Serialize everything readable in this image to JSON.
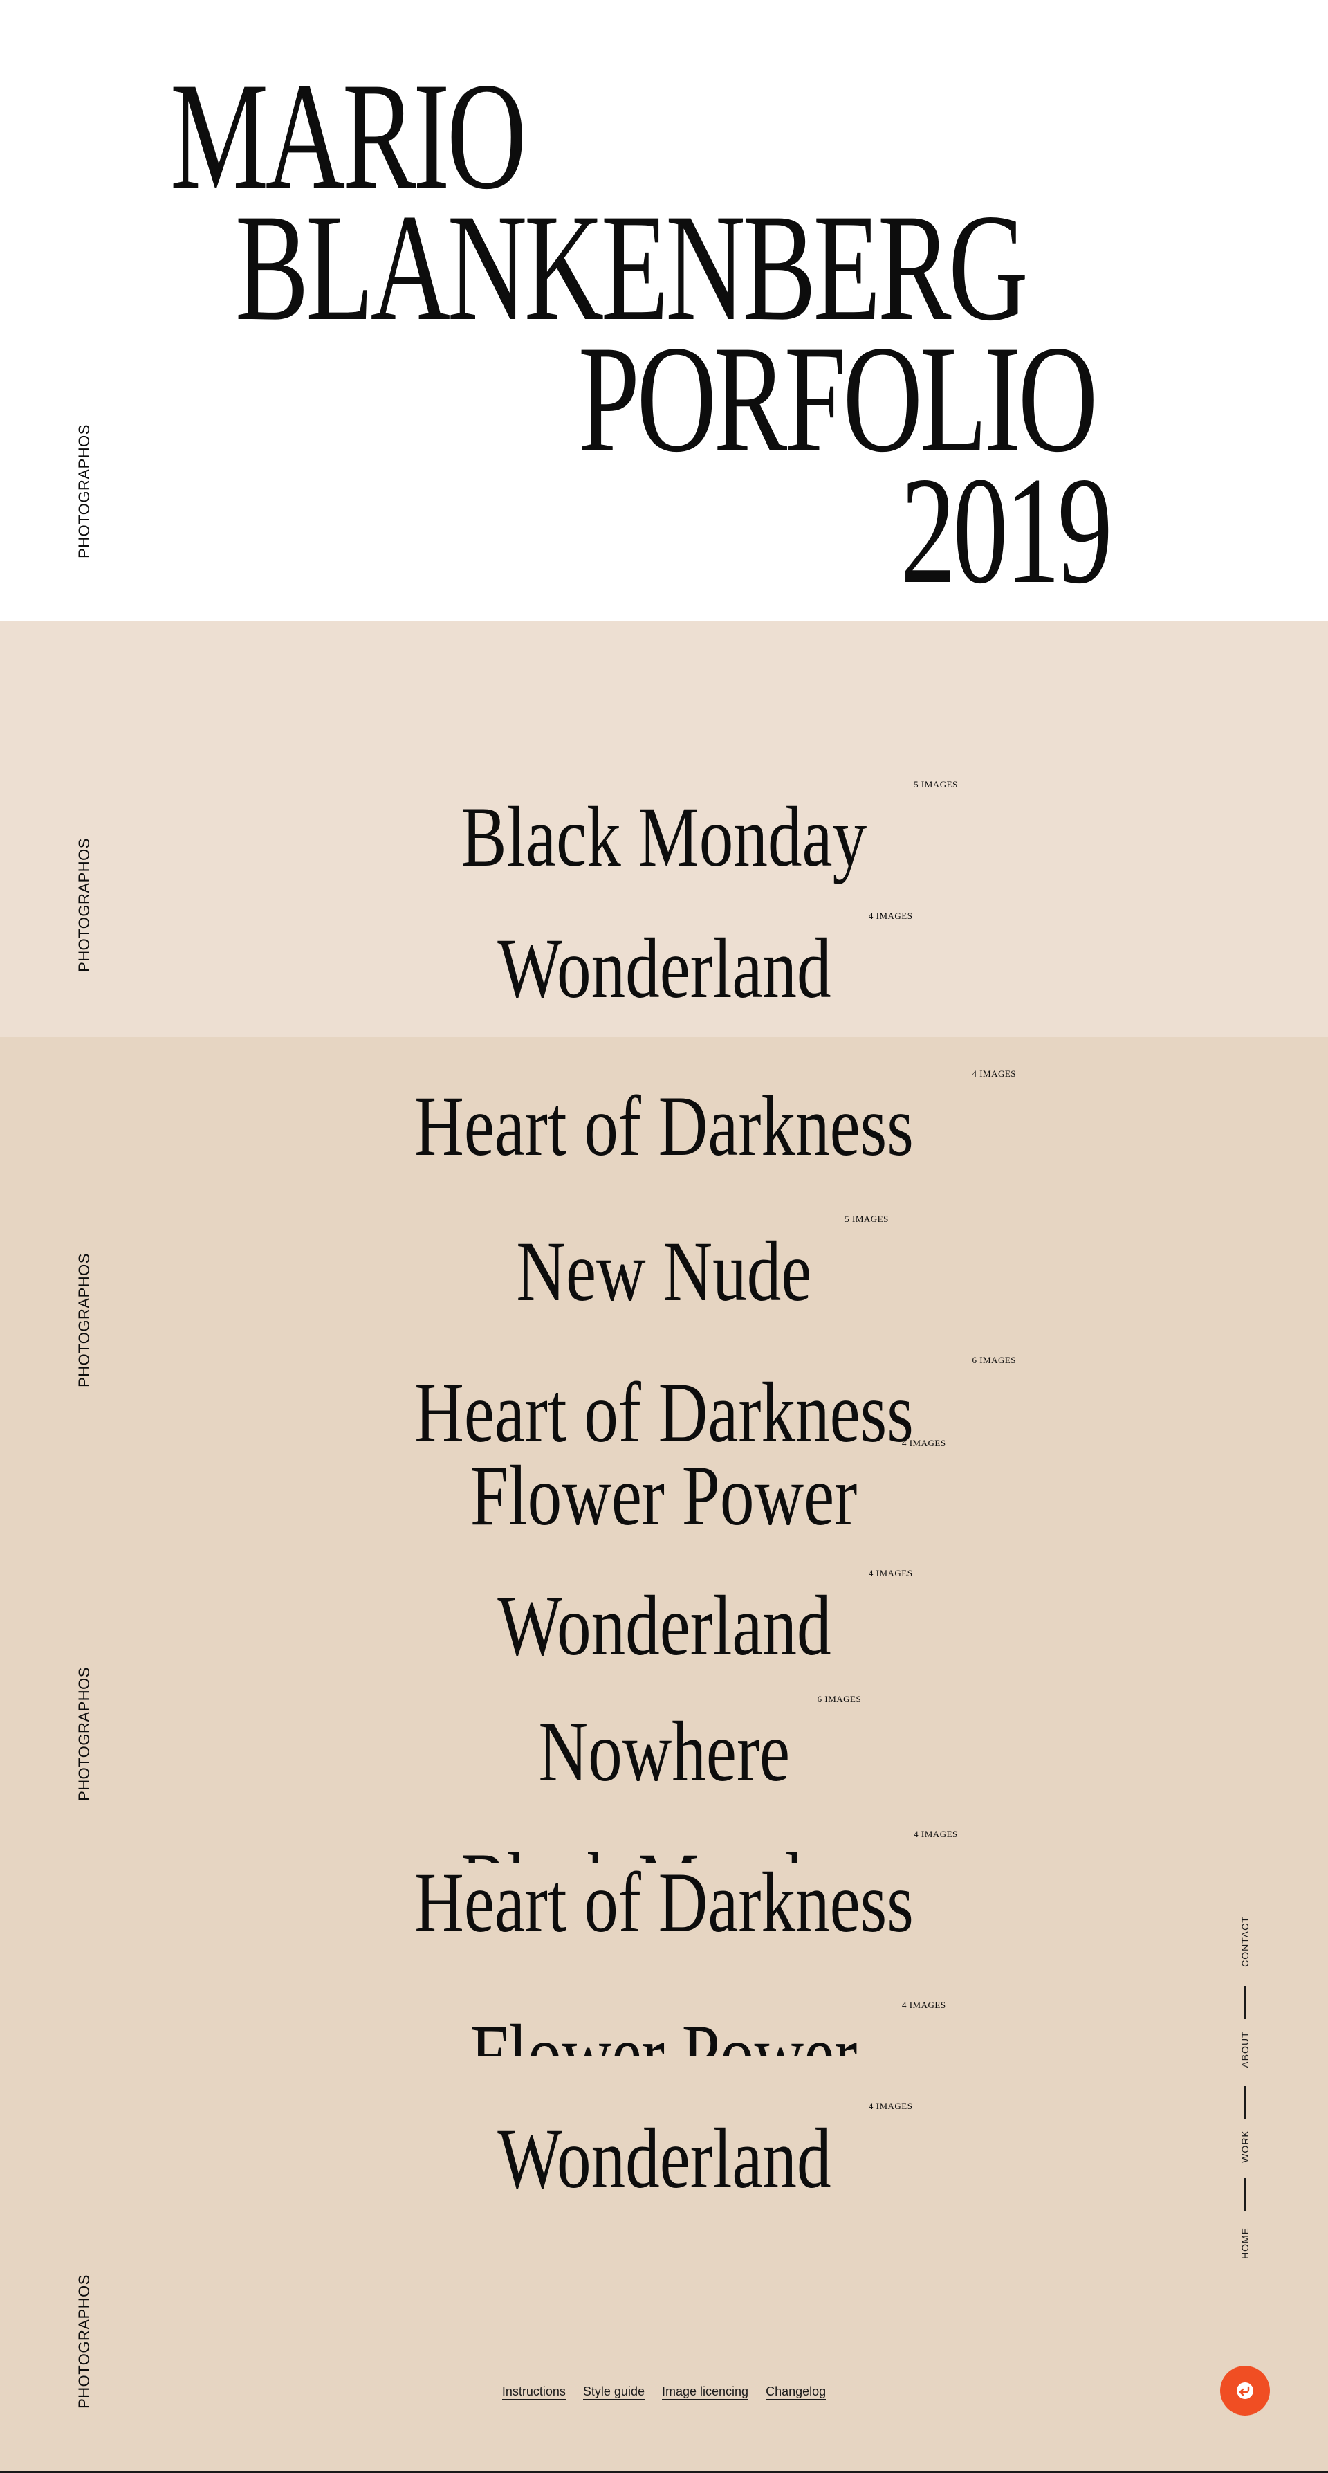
{
  "hero": {
    "title_lines": [
      "MARIO",
      "BLANKENBERG",
      "PORFOLIO",
      "2019"
    ]
  },
  "side_labels": [
    "PHOTOGRAPHOS",
    "PHOTOGRAPHOS",
    "PHOTOGRAPHOS",
    "PHOTOGRAPHOS",
    "PHOTOGRAPHOS"
  ],
  "projects": [
    {
      "title": "Black Monday",
      "count": "5 IMAGES"
    },
    {
      "title": "Wonderland",
      "count": "4 IMAGES"
    },
    {
      "title": "Heart of Darkness",
      "count": "4 IMAGES"
    },
    {
      "title": "New Nude",
      "count": "5 IMAGES"
    },
    {
      "title": "Heart of Darkness",
      "count": "6 IMAGES"
    },
    {
      "title": "Flower Power",
      "count": "4 IMAGES"
    },
    {
      "title": "Wonderland",
      "count": "4 IMAGES"
    },
    {
      "title": "Nowhere",
      "count": "6 IMAGES"
    },
    {
      "title": "Black Monday",
      "count": "4 IMAGES"
    },
    {
      "title": "Heart of Darkness",
      "count": ""
    },
    {
      "title": "Flower Power",
      "count": "4 IMAGES"
    },
    {
      "title": "Wonderland",
      "count": "4 IMAGES"
    }
  ],
  "side_nav": {
    "items": [
      "CONTACT",
      "ABOUT",
      "WORK",
      "HOME"
    ]
  },
  "footer": {
    "links": [
      "Instructions",
      "Style guide",
      "Image licencing",
      "Changelog"
    ]
  },
  "colors": {
    "hero_bg": "#ffffff",
    "section_bg_light": "#eddfd2",
    "section_bg": "#e6d5c2",
    "text": "#0d0d0d",
    "accent": "#f04e23"
  },
  "icons": {
    "fab": "return-arrow-icon"
  }
}
